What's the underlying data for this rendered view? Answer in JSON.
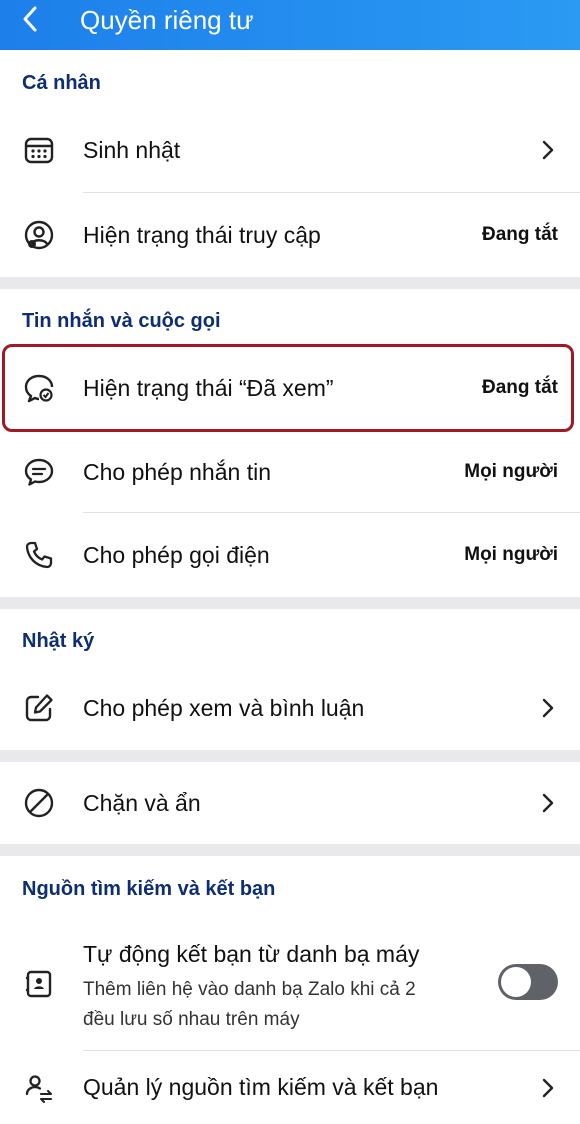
{
  "header": {
    "title": "Quyền riêng tư"
  },
  "sections": {
    "personal": {
      "title": "Cá nhân",
      "birthday": {
        "label": "Sinh nhật"
      },
      "access_status": {
        "label": "Hiện trạng thái truy cập",
        "value": "Đang tắt"
      }
    },
    "messages": {
      "title": "Tin nhắn và cuộc gọi",
      "seen_status": {
        "label": "Hiện trạng thái “Đã xem”",
        "value": "Đang tắt"
      },
      "allow_messaging": {
        "label": "Cho phép nhắn tin",
        "value": "Mọi người"
      },
      "allow_calls": {
        "label": "Cho phép gọi điện",
        "value": "Mọi người"
      }
    },
    "diary": {
      "title": "Nhật ký",
      "view_comment": {
        "label": "Cho phép xem và bình luận"
      }
    },
    "block": {
      "block_hide": {
        "label": "Chặn và ẩn"
      }
    },
    "sources": {
      "title": "Nguồn tìm kiếm và kết bạn",
      "auto_friend": {
        "label": "Tự động kết bạn từ danh bạ máy",
        "description_line1": "Thêm liên hệ vào danh bạ Zalo khi cả 2",
        "description_line2": "đều lưu số nhau trên máy",
        "enabled": false
      },
      "manage_sources": {
        "label": "Quản lý nguồn tìm kiếm và kết bạn"
      }
    }
  },
  "colors": {
    "header": "#1d7fea",
    "section_title": "#0d2e73",
    "highlight": "#a01924"
  }
}
